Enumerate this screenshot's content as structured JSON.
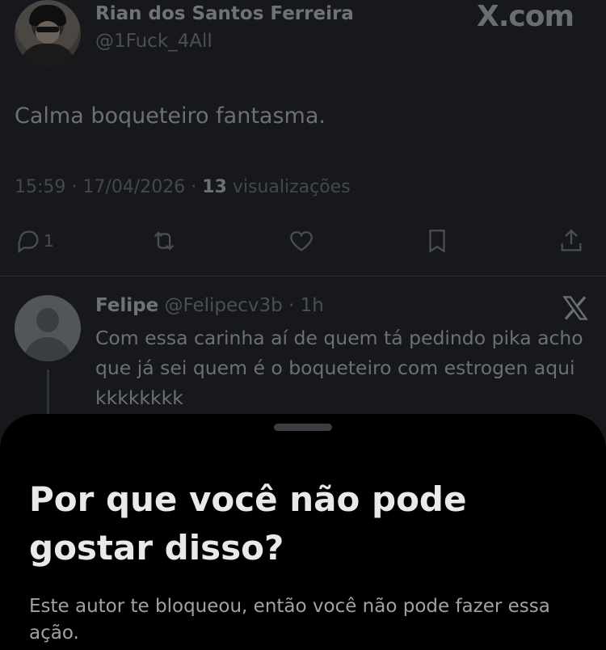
{
  "post": {
    "author_name": "Rian dos Santos Ferreira",
    "author_handle": "@1Fuck_4All",
    "site_label": "X.com",
    "text": "Calma boqueteiro fantasma.",
    "time": "15:59",
    "date": "17/04/2026",
    "views_count": "13",
    "views_label": "visualizações",
    "actions": {
      "reply_count": "1",
      "icons": [
        "reply-icon",
        "repost-icon",
        "like-icon",
        "bookmark-icon",
        "share-icon"
      ]
    }
  },
  "reply": {
    "name": "Felipe",
    "handle": "@Felipecv3b",
    "age": "1h",
    "text": "Com essa carinha aí de quem tá pedindo pika acho que já sei quem é o boqueteiro com estrogen aqui kkkkkkkk"
  },
  "sheet": {
    "title": "Por que você não pode gostar disso?",
    "body": "Este autor te bloqueou, então você não pode fazer essa ação."
  },
  "colors": {
    "sheet_bg": "#000000",
    "title": "#e7e9ea",
    "body": "#9ea3a8",
    "dimmed_bg": "#16181c"
  }
}
